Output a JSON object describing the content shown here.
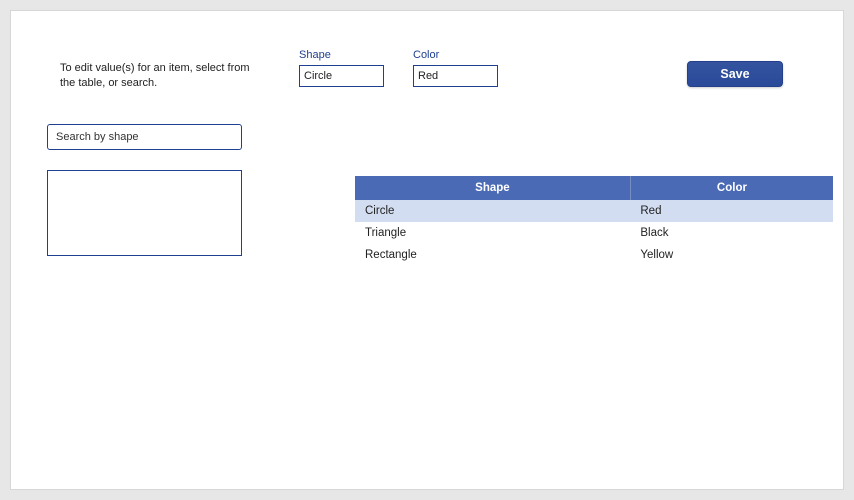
{
  "instructions": "To edit value(s) for an item, select from the table, or search.",
  "fields": {
    "shape": {
      "label": "Shape",
      "value": "Circle"
    },
    "color": {
      "label": "Color",
      "value": "Red"
    }
  },
  "buttons": {
    "save": "Save"
  },
  "search": {
    "placeholder": "Search by shape"
  },
  "table": {
    "headers": [
      "Shape",
      "Color"
    ],
    "rows": [
      {
        "shape": "Circle",
        "color": "Red"
      },
      {
        "shape": "Triangle",
        "color": "Black"
      },
      {
        "shape": "Rectangle",
        "color": "Yellow"
      }
    ]
  }
}
